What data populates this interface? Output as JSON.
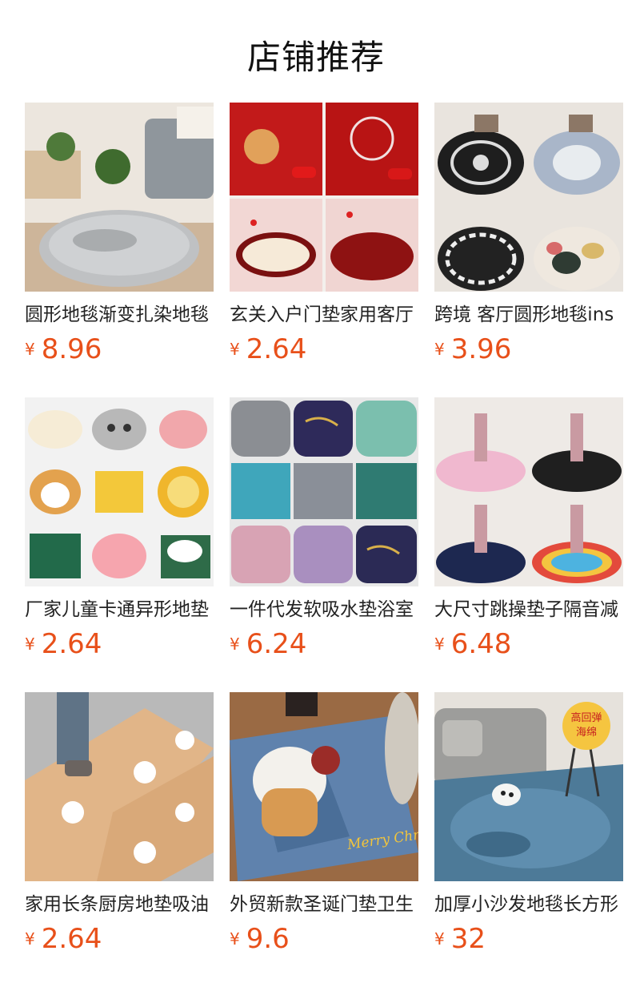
{
  "page": {
    "title": "店铺推荐"
  },
  "products": [
    {
      "name": "圆形地毯渐变扎染地毯",
      "currency": "¥",
      "price": "8.96",
      "image": "round-grey-shag-rug"
    },
    {
      "name": "玄关入户门垫家用客厅",
      "currency": "¥",
      "price": "2.64",
      "image": "red-wedding-door-mats"
    },
    {
      "name": "跨境 客厅圆形地毯ins",
      "currency": "¥",
      "price": "3.96",
      "image": "round-pattern-rugs"
    },
    {
      "name": "厂家儿童卡通异形地垫",
      "currency": "¥",
      "price": "2.64",
      "image": "cartoon-animal-mats"
    },
    {
      "name": "一件代发软吸水垫浴室",
      "currency": "¥",
      "price": "6.24",
      "image": "marble-bath-mats"
    },
    {
      "name": "大尺寸跳操垫子隔音减",
      "currency": "¥",
      "price": "6.48",
      "image": "round-jump-mats"
    },
    {
      "name": "家用长条厨房地垫吸油",
      "currency": "¥",
      "price": "2.64",
      "image": "cat-paw-kitchen-mats"
    },
    {
      "name": "外贸新款圣诞门垫卫生",
      "currency": "¥",
      "price": "9.6",
      "image": "christmas-door-mat",
      "mat_text": "Merry Christmas"
    },
    {
      "name": "加厚小沙发地毯长方形",
      "currency": "¥",
      "price": "32",
      "image": "blue-shag-rug",
      "badge": "高回弹\n海绵"
    }
  ]
}
